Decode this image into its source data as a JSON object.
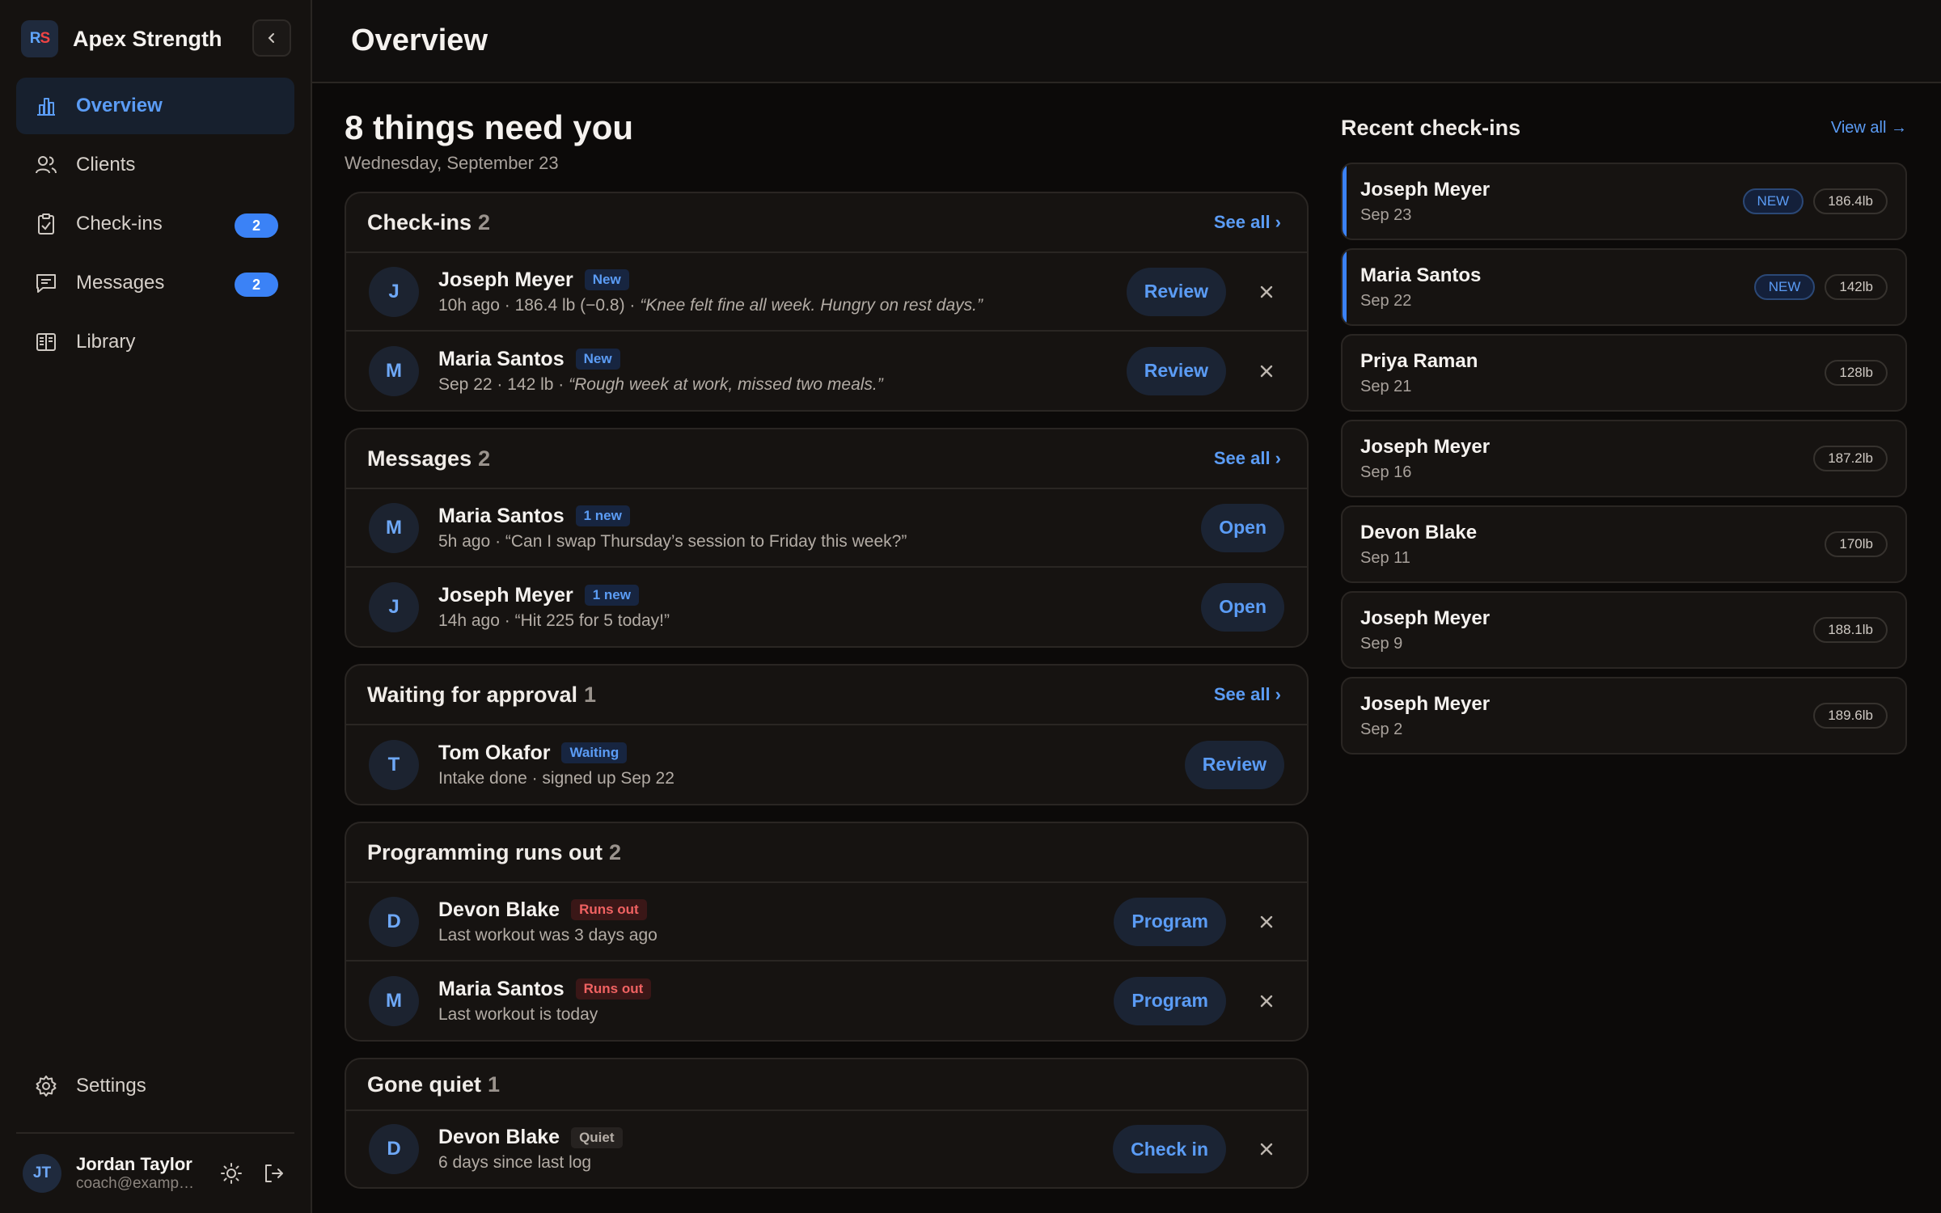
{
  "brand": {
    "name": "Apex Strength",
    "logo_left": "R",
    "logo_right": "S"
  },
  "sidebar": {
    "items": [
      {
        "label": "Overview",
        "icon": "bar-chart-icon"
      },
      {
        "label": "Clients",
        "icon": "users-icon"
      },
      {
        "label": "Check-ins",
        "icon": "clipboard-check-icon",
        "badge": "2"
      },
      {
        "label": "Messages",
        "icon": "message-icon",
        "badge": "2"
      },
      {
        "label": "Library",
        "icon": "book-icon"
      }
    ],
    "settings_label": "Settings"
  },
  "user": {
    "initials": "JT",
    "name": "Jordan Taylor",
    "email": "coach@example.com"
  },
  "topbar": {
    "title": "Overview"
  },
  "summary": {
    "headline": "8 things need you",
    "date": "Wednesday, September 23"
  },
  "sections": {
    "checkins": {
      "title": "Check-ins",
      "count": "2",
      "see_all": "See all ›",
      "rows": [
        {
          "initial": "J",
          "name": "Joseph Meyer",
          "tag": "New",
          "meta": "10h ago · 186.4 lb (−0.8) · ",
          "quote": "“Knee felt fine all week. Hungry on rest days.”",
          "action": "Review"
        },
        {
          "initial": "M",
          "name": "Maria Santos",
          "tag": "New",
          "meta": "Sep 22 · 142 lb · ",
          "quote": "“Rough week at work, missed two meals.”",
          "action": "Review"
        }
      ]
    },
    "messages": {
      "title": "Messages",
      "count": "2",
      "see_all": "See all ›",
      "rows": [
        {
          "initial": "M",
          "name": "Maria Santos",
          "tag": "1 new",
          "sub": "5h ago · “Can I swap Thursday’s session to Friday this week?”",
          "action": "Open"
        },
        {
          "initial": "J",
          "name": "Joseph Meyer",
          "tag": "1 new",
          "sub": "14h ago · “Hit 225 for 5 today!”",
          "action": "Open"
        }
      ]
    },
    "approval": {
      "title": "Waiting for approval",
      "count": "1",
      "see_all": "See all ›",
      "rows": [
        {
          "initial": "T",
          "name": "Tom Okafor",
          "tag": "Waiting",
          "sub": "Intake done · signed up Sep 22",
          "action": "Review"
        }
      ]
    },
    "programming": {
      "title": "Programming runs out",
      "count": "2",
      "rows": [
        {
          "initial": "D",
          "name": "Devon Blake",
          "tag": "Runs out",
          "sub": "Last workout was 3 days ago",
          "action": "Program"
        },
        {
          "initial": "M",
          "name": "Maria Santos",
          "tag": "Runs out",
          "sub": "Last workout is today",
          "action": "Program"
        }
      ]
    },
    "quiet": {
      "title": "Gone quiet",
      "count": "1",
      "rows": [
        {
          "initial": "D",
          "name": "Devon Blake",
          "tag": "Quiet",
          "sub": "6 days since last log",
          "action": "Check in"
        }
      ]
    }
  },
  "recent": {
    "title": "Recent check-ins",
    "view_all": "View all →",
    "items": [
      {
        "name": "Joseph Meyer",
        "date": "Sep 23",
        "new": "NEW",
        "weight": "186.4lb"
      },
      {
        "name": "Maria Santos",
        "date": "Sep 22",
        "new": "NEW",
        "weight": "142lb"
      },
      {
        "name": "Priya Raman",
        "date": "Sep 21",
        "weight": "128lb"
      },
      {
        "name": "Joseph Meyer",
        "date": "Sep 16",
        "weight": "187.2lb"
      },
      {
        "name": "Devon Blake",
        "date": "Sep 11",
        "weight": "170lb"
      },
      {
        "name": "Joseph Meyer",
        "date": "Sep 9",
        "weight": "188.1lb"
      },
      {
        "name": "Joseph Meyer",
        "date": "Sep 2",
        "weight": "189.6lb"
      }
    ]
  },
  "colors": {
    "accent": "#3b82f6",
    "danger": "#f06262",
    "background": "#0c0a09"
  }
}
